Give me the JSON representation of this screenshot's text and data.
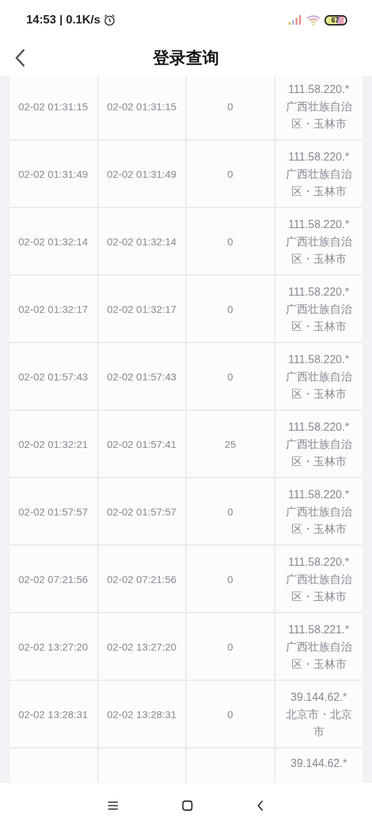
{
  "status_bar": {
    "time": "14:53 | 0.1K/s",
    "battery": "67"
  },
  "header": {
    "title": "登录查询"
  },
  "rows": [
    {
      "col1": "02-02 01:31:15",
      "col2": "02-02 01:31:15",
      "col3": "0",
      "ip": "111.58.220.*",
      "location": "广西壮族自治区・玉林市"
    },
    {
      "col1": "02-02 01:31:49",
      "col2": "02-02 01:31:49",
      "col3": "0",
      "ip": "111.58.220.*",
      "location": "广西壮族自治区・玉林市"
    },
    {
      "col1": "02-02 01:32:14",
      "col2": "02-02 01:32:14",
      "col3": "0",
      "ip": "111.58.220.*",
      "location": "广西壮族自治区・玉林市"
    },
    {
      "col1": "02-02 01:32:17",
      "col2": "02-02 01:32:17",
      "col3": "0",
      "ip": "111.58.220.*",
      "location": "广西壮族自治区・玉林市"
    },
    {
      "col1": "02-02 01:57:43",
      "col2": "02-02 01:57:43",
      "col3": "0",
      "ip": "111.58.220.*",
      "location": "广西壮族自治区・玉林市"
    },
    {
      "col1": "02-02 01:32:21",
      "col2": "02-02 01:57:41",
      "col3": "25",
      "ip": "111.58.220.*",
      "location": "广西壮族自治区・玉林市"
    },
    {
      "col1": "02-02 01:57:57",
      "col2": "02-02 01:57:57",
      "col3": "0",
      "ip": "111.58.220.*",
      "location": "广西壮族自治区・玉林市"
    },
    {
      "col1": "02-02 07:21:56",
      "col2": "02-02 07:21:56",
      "col3": "0",
      "ip": "111.58.220.*",
      "location": "广西壮族自治区・玉林市"
    },
    {
      "col1": "02-02 13:27:20",
      "col2": "02-02 13:27:20",
      "col3": "0",
      "ip": "111.58.221.*",
      "location": "广西壮族自治区・玉林市"
    },
    {
      "col1": "02-02 13:28:31",
      "col2": "02-02 13:28:31",
      "col3": "0",
      "ip": "39.144.62.*",
      "location": "北京市・北京市"
    },
    {
      "ip": "39.144.62.*"
    }
  ]
}
